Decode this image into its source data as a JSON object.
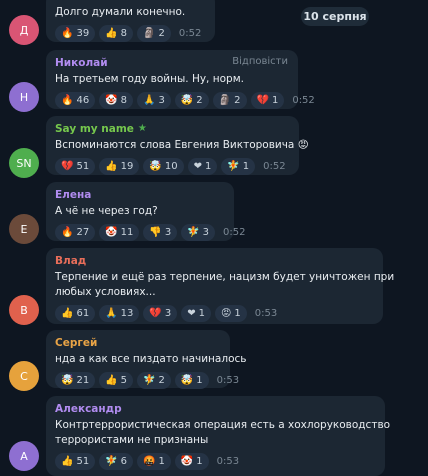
{
  "date_badge": "10 серпня",
  "reply_label": "Відповісти",
  "colors": {
    "background": "#0e1621",
    "bubble": "#1c2733",
    "reaction_pill": "#253345"
  },
  "messages": [
    {
      "avatar_letter": "Д",
      "avatar_color": "#d95574",
      "author": "",
      "author_color": "",
      "lines": [
        "Долго думали конечно."
      ],
      "reactions": [
        {
          "emoji": "🔥",
          "count": "39"
        },
        {
          "emoji": "👍",
          "count": "8"
        },
        {
          "emoji": "🗿",
          "count": "2"
        }
      ],
      "time": "0:52"
    },
    {
      "avatar_letter": "Н",
      "avatar_color": "#8e6fd1",
      "author": "Николай",
      "author_color": "#b18cf0",
      "lines": [
        "На третьем году войны. Ну, норм."
      ],
      "reactions": [
        {
          "emoji": "🔥",
          "count": "46"
        },
        {
          "emoji": "🤡",
          "count": "8"
        },
        {
          "emoji": "🙏",
          "count": "3"
        },
        {
          "emoji": "🤯",
          "count": "2"
        },
        {
          "emoji": "🗿",
          "count": "2"
        },
        {
          "emoji": "💔",
          "count": "1"
        }
      ],
      "time": "0:52"
    },
    {
      "avatar_letter": "SN",
      "avatar_color": "#4fae4e",
      "author": "Say my name",
      "author_color": "#76c84d",
      "badge": "★",
      "lines": [
        "Вспоминаются слова Евгения Викторовича 😡"
      ],
      "reactions": [
        {
          "emoji": "💔",
          "count": "51"
        },
        {
          "emoji": "👍",
          "count": "19"
        },
        {
          "emoji": "🤯",
          "count": "10"
        },
        {
          "emoji": "❤",
          "count": "1"
        },
        {
          "emoji": "🧚",
          "count": "1"
        }
      ],
      "time": "0:52"
    },
    {
      "avatar_letter": "Е",
      "avatar_color": "#6b4a3a",
      "author": "Елена",
      "author_color": "#b18cf0",
      "lines": [
        "А чё не через год?"
      ],
      "reactions": [
        {
          "emoji": "🔥",
          "count": "27"
        },
        {
          "emoji": "🤡",
          "count": "11"
        },
        {
          "emoji": "👎",
          "count": "3"
        },
        {
          "emoji": "🧚",
          "count": "3"
        }
      ],
      "time": "0:52"
    },
    {
      "avatar_letter": "В",
      "avatar_color": "#e0614d",
      "author": "Влад",
      "author_color": "#e86e5a",
      "lines": [
        "Терпение и ещё раз терпение, нацизм будет уничтожен при",
        "любых условиях..."
      ],
      "reactions": [
        {
          "emoji": "👍",
          "count": "61"
        },
        {
          "emoji": "🙏",
          "count": "13"
        },
        {
          "emoji": "💔",
          "count": "3"
        },
        {
          "emoji": "❤",
          "count": "1"
        },
        {
          "emoji": "😡",
          "count": "1"
        }
      ],
      "time": "0:53"
    },
    {
      "avatar_letter": "С",
      "avatar_color": "#e6a23c",
      "author": "Сергей",
      "author_color": "#e9a446",
      "lines": [
        "нда а как все пиздато начиналось"
      ],
      "reactions": [
        {
          "emoji": "🤯",
          "count": "21"
        },
        {
          "emoji": "👍",
          "count": "5"
        },
        {
          "emoji": "🧚",
          "count": "2"
        },
        {
          "emoji": "🤯",
          "count": "1"
        }
      ],
      "time": "0:53"
    },
    {
      "avatar_letter": "А",
      "avatar_color": "#8e6fd1",
      "author": "Александр",
      "author_color": "#b18cf0",
      "lines": [
        "Контртеррористическая операция есть а хохлоруководство",
        "террористами не признаны"
      ],
      "reactions": [
        {
          "emoji": "👍",
          "count": "51"
        },
        {
          "emoji": "🧚",
          "count": "6"
        },
        {
          "emoji": "🤬",
          "count": "1"
        },
        {
          "emoji": "🤡",
          "count": "1"
        }
      ],
      "time": "0:53"
    }
  ]
}
